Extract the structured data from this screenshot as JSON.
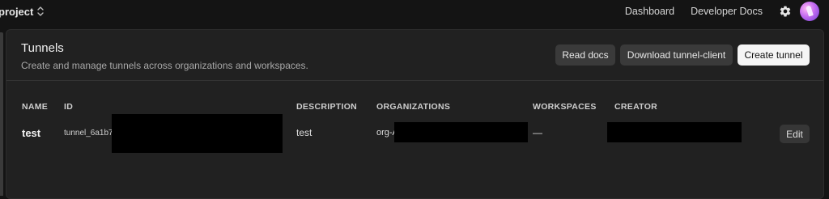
{
  "topbar": {
    "project_label": "project",
    "nav": {
      "dashboard": "Dashboard",
      "developer_docs": "Developer Docs"
    }
  },
  "panel": {
    "title": "Tunnels",
    "subtitle": "Create and manage tunnels across organizations and workspaces.",
    "buttons": {
      "read_docs": "Read docs",
      "download_client": "Download tunnel-client",
      "create_tunnel": "Create tunnel"
    }
  },
  "table": {
    "columns": [
      "NAME",
      "ID",
      "DESCRIPTION",
      "ORGANIZATIONS",
      "WORKSPACES",
      "CREATOR"
    ],
    "rows": [
      {
        "name": "test",
        "id": "tunnel_6a1b7",
        "description": "test",
        "organizations": "org-A",
        "workspaces": "—",
        "creator": "",
        "edit_label": "Edit"
      }
    ]
  }
}
